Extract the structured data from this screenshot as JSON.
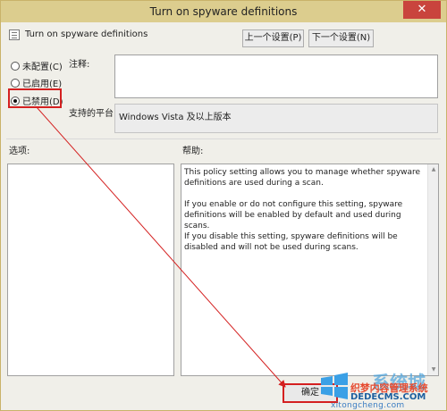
{
  "window": {
    "title": "Turn on spyware definitions",
    "close_glyph": "✕"
  },
  "header": {
    "title": "Turn on spyware definitions",
    "prev_label": "上一个设置(P)",
    "next_label": "下一个设置(N)"
  },
  "options": {
    "items": [
      {
        "label": "未配置(C)",
        "selected": false
      },
      {
        "label": "已启用(E)",
        "selected": false
      },
      {
        "label": "已禁用(D)",
        "selected": true
      }
    ]
  },
  "comment": {
    "label": "注释:",
    "value": ""
  },
  "platform": {
    "label": "支持的平台:",
    "value": "Windows Vista 及以上版本"
  },
  "options_section": {
    "label": "选项:"
  },
  "help_section": {
    "label": "帮助:",
    "paragraphs": [
      "This policy setting allows you to manage whether spyware definitions are used during a scan.",
      "If you enable or do not configure this setting, spyware definitions will be enabled by default and used during scans.",
      "If you disable this setting, spyware definitions will be disabled and will not be used during scans."
    ]
  },
  "footer": {
    "ok_label": "确定"
  },
  "watermark": {
    "main": "织梦内容管理系统",
    "sub": "DEDECMS.COM",
    "big": "系统城",
    "url": "xitongcheng.com"
  },
  "colors": {
    "titlebar": "#dccd8e",
    "highlight": "#d42020",
    "close": "#c9443d"
  },
  "icons": [
    "policy-icon",
    "close-icon",
    "windows-logo-icon"
  ]
}
